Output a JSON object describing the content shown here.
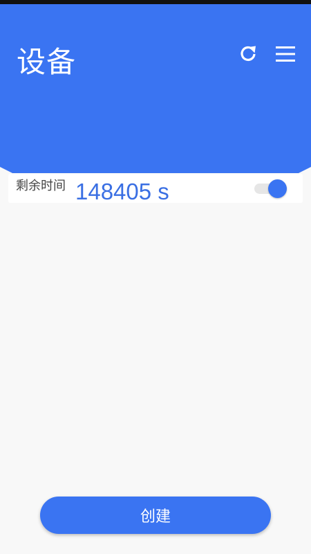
{
  "header": {
    "title": "设备",
    "refresh_icon": "refresh-icon",
    "menu_icon": "menu-icon",
    "background_color": "#3a74f2"
  },
  "timer": {
    "label": "剩余时间",
    "value": "148405 s",
    "enabled": true,
    "value_color": "#3a6fe3"
  },
  "footer": {
    "create_label": "创建"
  }
}
